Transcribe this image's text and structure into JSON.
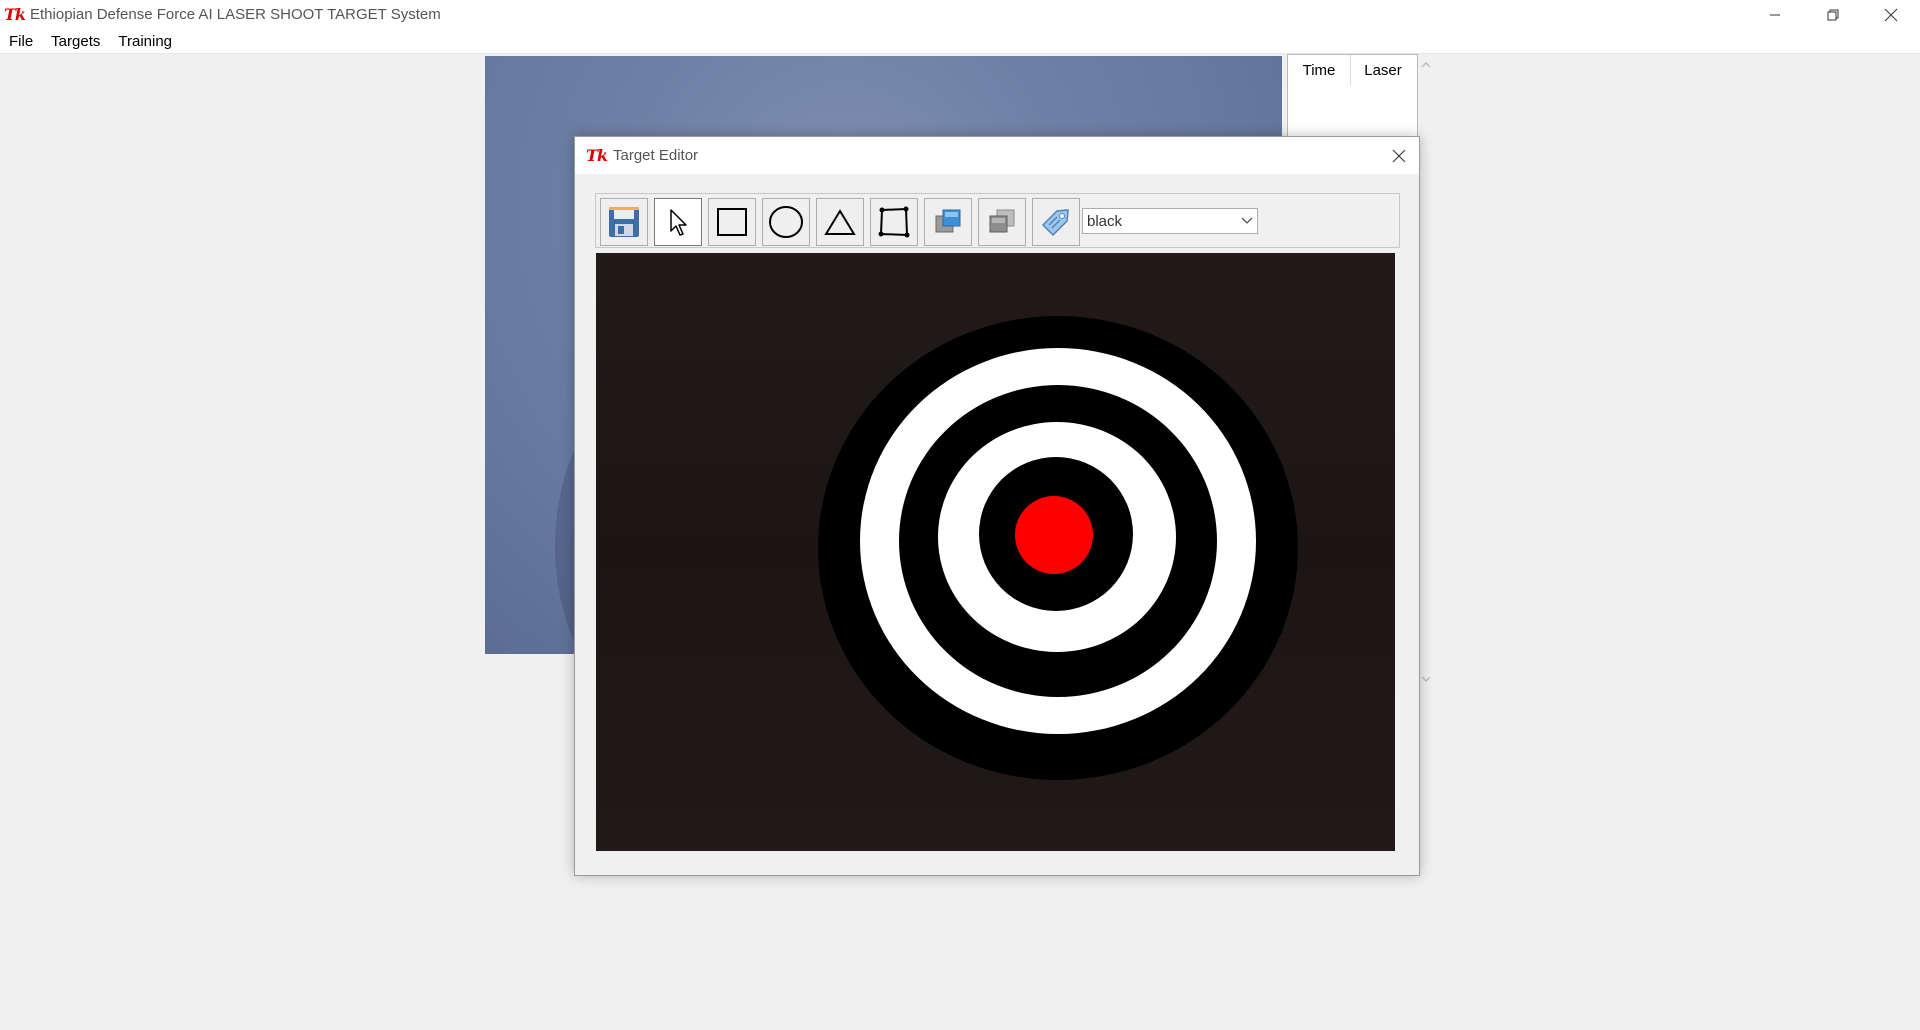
{
  "app": {
    "title": "Ethiopian Defense Force AI LASER SHOOT TARGET System",
    "logo": "Tk"
  },
  "window_controls": {
    "minimize_icon": "minimize-icon",
    "restore_icon": "restore-icon",
    "close_icon": "close-icon"
  },
  "menu": {
    "items": [
      "File",
      "Targets",
      "Training"
    ]
  },
  "results_table": {
    "columns": [
      "Time",
      "Laser"
    ]
  },
  "target_editor": {
    "title": "Target Editor",
    "logo": "Tk",
    "toolbar": {
      "buttons": [
        {
          "icon": "save-icon"
        },
        {
          "icon": "pointer-icon",
          "active": true
        },
        {
          "icon": "rectangle-icon"
        },
        {
          "icon": "oval-icon"
        },
        {
          "icon": "triangle-icon"
        },
        {
          "icon": "polygon-icon"
        },
        {
          "icon": "bring-to-front-icon"
        },
        {
          "icon": "send-to-back-icon"
        },
        {
          "icon": "tag-icon"
        }
      ],
      "color_select": {
        "value": "black"
      }
    },
    "target": {
      "ring_colors": [
        "#000000",
        "#ffffff",
        "#000000",
        "#ffffff",
        "#000000"
      ],
      "bullseye_color": "#ff0000"
    }
  }
}
